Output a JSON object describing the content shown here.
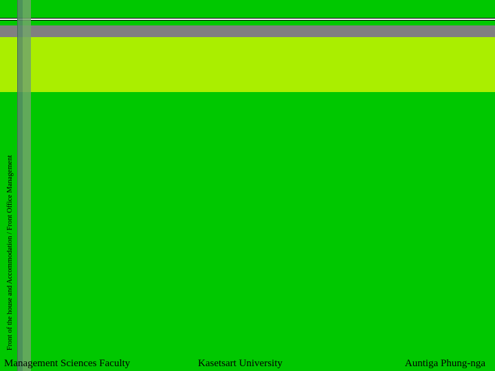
{
  "slide": {
    "side_title": "Front of the house and Accommodation / Front Office Management",
    "footer": {
      "left": "Management Sciences Faculty",
      "center": "Kasetsart University",
      "right": "Auntiga Phung-nga"
    }
  },
  "colors": {
    "background": "#00c800",
    "lime_band": "#aaee00",
    "gray_band": "#808080"
  }
}
